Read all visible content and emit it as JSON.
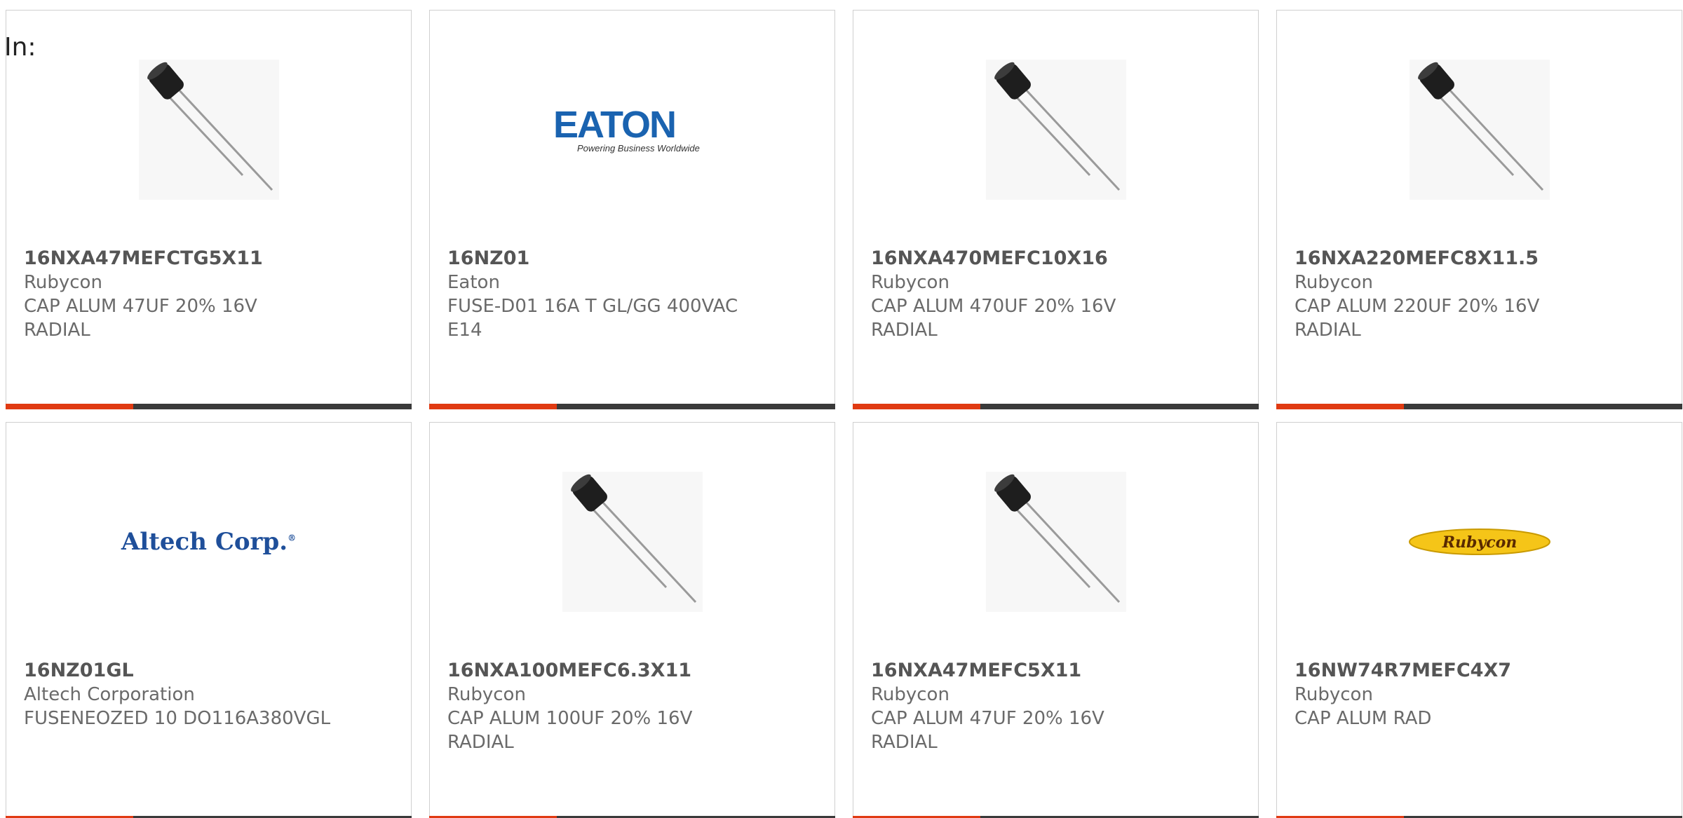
{
  "header": {
    "in_label": "In:"
  },
  "colors": {
    "accent_bar": "#e03a12",
    "bar_dark": "#3a3a3a",
    "eaton_blue": "#1a63b0",
    "altech_blue": "#1f4f9a",
    "rubycon_yellow": "#f5c518"
  },
  "products": [
    {
      "image": "capacitor-photo",
      "part_number": "16NXA47MEFCTG5X11",
      "manufacturer": "Rubycon",
      "description_line1": "CAP ALUM 47UF 20% 16V",
      "description_line2": "RADIAL"
    },
    {
      "image": "eaton-logo",
      "logo_text": "EATON",
      "logo_tagline": "Powering Business Worldwide",
      "part_number": "16NZ01",
      "manufacturer": "Eaton",
      "description_line1": "FUSE-D01 16A T GL/GG 400VAC",
      "description_line2": "E14"
    },
    {
      "image": "capacitor-photo",
      "part_number": "16NXA470MEFC10X16",
      "manufacturer": "Rubycon",
      "description_line1": "CAP ALUM 470UF 20% 16V",
      "description_line2": "RADIAL"
    },
    {
      "image": "capacitor-photo",
      "part_number": "16NXA220MEFC8X11.5",
      "manufacturer": "Rubycon",
      "description_line1": "CAP ALUM 220UF 20% 16V",
      "description_line2": "RADIAL"
    },
    {
      "image": "altech-logo",
      "logo_text": "Altech Corp.",
      "part_number": "16NZ01GL",
      "manufacturer": "Altech Corporation",
      "description_line1": "FUSENEOZED 10 DO116A380VGL",
      "description_line2": ""
    },
    {
      "image": "capacitor-photo",
      "part_number": "16NXA100MEFC6.3X11",
      "manufacturer": "Rubycon",
      "description_line1": "CAP ALUM 100UF 20% 16V",
      "description_line2": "RADIAL"
    },
    {
      "image": "capacitor-photo",
      "part_number": "16NXA47MEFC5X11",
      "manufacturer": "Rubycon",
      "description_line1": "CAP ALUM 47UF 20% 16V",
      "description_line2": "RADIAL"
    },
    {
      "image": "rubycon-logo",
      "logo_text": "Rubycon",
      "part_number": "16NW74R7MEFC4X7",
      "manufacturer": "Rubycon",
      "description_line1": "CAP ALUM RAD",
      "description_line2": ""
    }
  ]
}
